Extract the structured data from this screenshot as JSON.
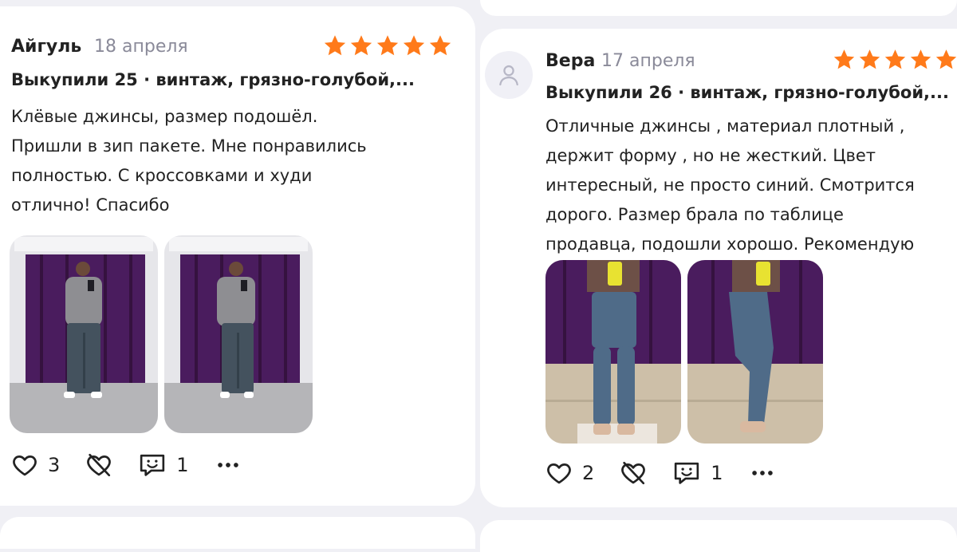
{
  "reviews": [
    {
      "author": "Айгуль",
      "date": "18 апреля",
      "rating": 5,
      "purchase": "Выкупили  25 · винтаж, грязно-голубой,...",
      "text_lines": [
        "Клёвые джинсы, размер подошёл.",
        "Пришли в зип пакете. Мне понравились",
        "полностью. С кроссовками и худи",
        "отлично! Спасибо"
      ],
      "likes": "3",
      "comments": "1",
      "photos": [
        "photo-fitting-room-front",
        "photo-fitting-room-front-2"
      ]
    },
    {
      "author": "Вера",
      "date": "17 апреля",
      "rating": 5,
      "purchase": "Выкупили  26 · винтаж, грязно-голубой,...",
      "text_lines": [
        "Отличные джинсы , материал плотный ,",
        "держит форму , но не жесткий. Цвет",
        "интересный, не просто синий. Смотрится",
        "дорого. Размер брала по таблице",
        "продавца, подошли хорошо. Рекомендую"
      ],
      "likes": "2",
      "comments": "1",
      "photos": [
        "photo-jeans-front",
        "photo-jeans-side"
      ]
    }
  ],
  "icons": {
    "star": "star-icon",
    "like": "heart-icon",
    "dislike": "heart-crossed-icon",
    "comment": "comment-icon",
    "more": "more-icon",
    "avatar": "user-icon"
  },
  "colors": {
    "star": "#ff7a1a",
    "muted": "#8a8a99",
    "purple": "#4a1c5e"
  }
}
